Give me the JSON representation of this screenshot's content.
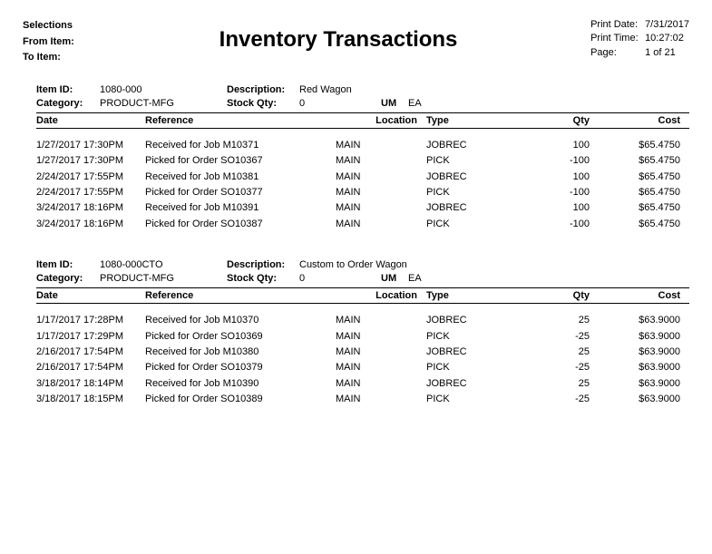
{
  "header": {
    "selections_label": "Selections",
    "from_item_label": "From Item:",
    "from_item_value": "",
    "to_item_label": "To Item:",
    "to_item_value": "",
    "title": "Inventory Transactions",
    "print_date_label": "Print Date:",
    "print_date_value": "7/31/2017",
    "print_time_label": "Print Time:",
    "print_time_value": "10:27:02",
    "page_label": "Page:",
    "page_value": "1 of 21"
  },
  "columns": {
    "date": "Date",
    "reference": "Reference",
    "location": "Location",
    "type": "Type",
    "qty": "Qty",
    "cost": "Cost"
  },
  "labels": {
    "item_id": "Item ID:",
    "description": "Description:",
    "category": "Category:",
    "stock_qty": "Stock Qty:",
    "um": "UM"
  },
  "blocks": [
    {
      "item_id": "1080-000",
      "description": "Red Wagon",
      "category": "PRODUCT-MFG",
      "stock_qty": "0",
      "um": "EA",
      "rows": [
        {
          "date": "1/27/2017 17:30PM",
          "ref": "Received for Job M10371",
          "loc": "MAIN",
          "type": "JOBREC",
          "qty": "100",
          "cost": "$65.4750"
        },
        {
          "date": "1/27/2017 17:30PM",
          "ref": "Picked for Order SO10367",
          "loc": "MAIN",
          "type": "PICK",
          "qty": "-100",
          "cost": "$65.4750"
        },
        {
          "date": "2/24/2017 17:55PM",
          "ref": "Received for Job M10381",
          "loc": "MAIN",
          "type": "JOBREC",
          "qty": "100",
          "cost": "$65.4750"
        },
        {
          "date": "2/24/2017 17:55PM",
          "ref": "Picked for Order SO10377",
          "loc": "MAIN",
          "type": "PICK",
          "qty": "-100",
          "cost": "$65.4750"
        },
        {
          "date": "3/24/2017 18:16PM",
          "ref": "Received for Job M10391",
          "loc": "MAIN",
          "type": "JOBREC",
          "qty": "100",
          "cost": "$65.4750"
        },
        {
          "date": "3/24/2017 18:16PM",
          "ref": "Picked for Order SO10387",
          "loc": "MAIN",
          "type": "PICK",
          "qty": "-100",
          "cost": "$65.4750"
        }
      ]
    },
    {
      "item_id": "1080-000CTO",
      "description": "Custom to Order Wagon",
      "category": "PRODUCT-MFG",
      "stock_qty": "0",
      "um": "EA",
      "rows": [
        {
          "date": "1/17/2017 17:28PM",
          "ref": "Received for Job M10370",
          "loc": "MAIN",
          "type": "JOBREC",
          "qty": "25",
          "cost": "$63.9000"
        },
        {
          "date": "1/17/2017 17:29PM",
          "ref": "Picked for Order SO10369",
          "loc": "MAIN",
          "type": "PICK",
          "qty": "-25",
          "cost": "$63.9000"
        },
        {
          "date": "2/16/2017 17:54PM",
          "ref": "Received for Job M10380",
          "loc": "MAIN",
          "type": "JOBREC",
          "qty": "25",
          "cost": "$63.9000"
        },
        {
          "date": "2/16/2017 17:54PM",
          "ref": "Picked for Order SO10379",
          "loc": "MAIN",
          "type": "PICK",
          "qty": "-25",
          "cost": "$63.9000"
        },
        {
          "date": "3/18/2017 18:14PM",
          "ref": "Received for Job M10390",
          "loc": "MAIN",
          "type": "JOBREC",
          "qty": "25",
          "cost": "$63.9000"
        },
        {
          "date": "3/18/2017 18:15PM",
          "ref": "Picked for Order SO10389",
          "loc": "MAIN",
          "type": "PICK",
          "qty": "-25",
          "cost": "$63.9000"
        }
      ]
    }
  ]
}
